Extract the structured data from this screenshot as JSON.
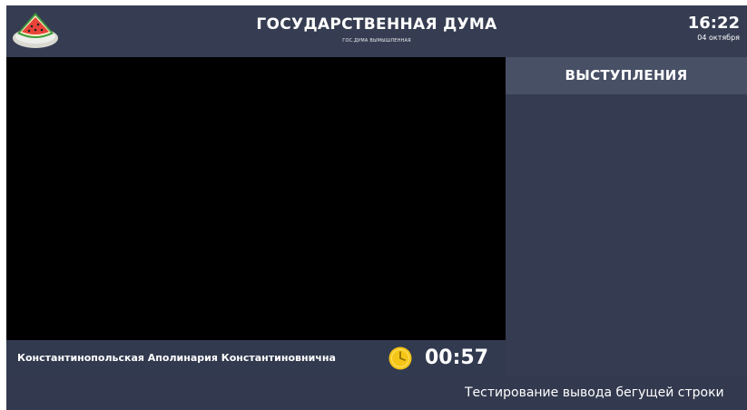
{
  "header": {
    "title": "ГОСУДАРСТВЕННАЯ ДУМА",
    "subtitle": "ГОС.ДУМА ВЫМЫШЛЕННАЯ",
    "logo_icon": "watermelon-icon",
    "time": "16:22",
    "date": "04 октября"
  },
  "sidebar": {
    "heading": "ВЫСТУПЛЕНИЯ"
  },
  "speaker": {
    "name": "Константинопольская Аполинария Константиновнична",
    "timer": "00:57",
    "timer_icon": "clock-icon"
  },
  "ticker": {
    "text": "Тестирование вывода бегущей строки"
  },
  "colors": {
    "background": "#333a4f",
    "sidebar_heading": "#485066",
    "video": "#000000",
    "timer_icon": "#f5c518"
  }
}
